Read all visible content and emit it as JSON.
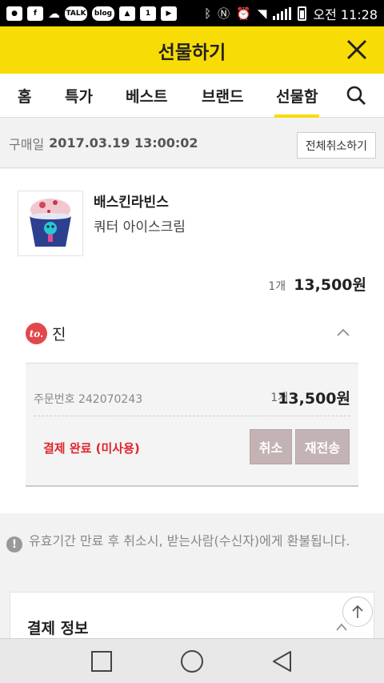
{
  "status_bar": {
    "left_icons": [
      "kakaostory-icon",
      "facebook-icon",
      "cloud-icon",
      "talk-icon",
      "blog-icon",
      "gallery-icon",
      "one-icon",
      "play-icon"
    ],
    "talk_label": "TALK",
    "blog_label": "blog",
    "clock": "오전 11:28"
  },
  "header": {
    "title": "선물하기"
  },
  "tabs": [
    {
      "label": "홈"
    },
    {
      "label": "특가"
    },
    {
      "label": "베스트"
    },
    {
      "label": "브랜드"
    },
    {
      "label": "선물함",
      "active": true
    }
  ],
  "purchase": {
    "date_label": "구매일",
    "date_value": "2017.03.19 13:00:02",
    "cancel_all_label": "전체취소하기"
  },
  "item": {
    "brand": "배스킨라빈스",
    "product": "쿼터 아이스크림",
    "qty": "1개",
    "price": "13,500원"
  },
  "recipient": {
    "badge": "to.",
    "name": "진"
  },
  "order": {
    "number_label": "주문번호 242070243",
    "qty": "1개",
    "price": "13,500원",
    "status": "결제 완료 (미사용)",
    "cancel_label": "취소",
    "resend_label": "재전송"
  },
  "notice": {
    "text": "유효기간 만료 후 취소시, 받는사람(수신자)에게 환불됩니다."
  },
  "payment": {
    "title": "결제 정보"
  },
  "colors": {
    "header_yellow": "#f8dc06",
    "status_red": "#e0242b",
    "to_badge_red": "#e2474a",
    "action_button": "#c4b3b4"
  }
}
